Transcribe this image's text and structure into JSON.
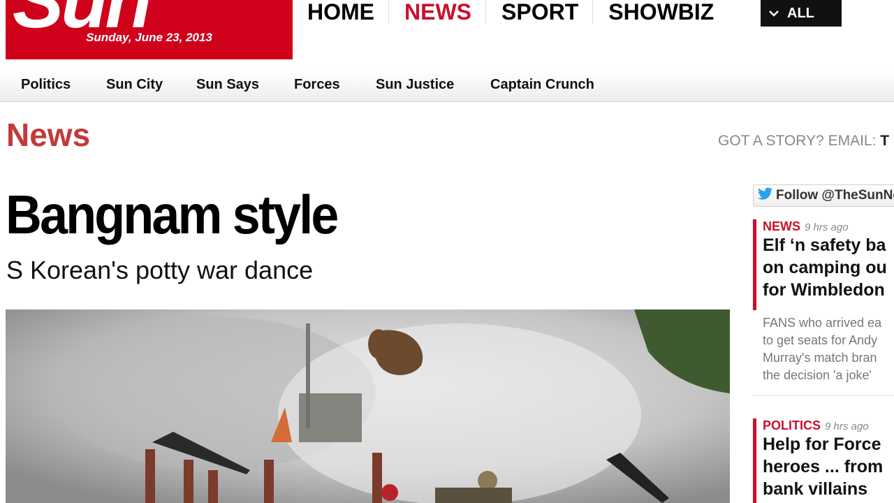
{
  "masthead": {
    "logo_text": "Sun",
    "date": "Sunday, June 23, 2013",
    "brand_color": "#d0021b"
  },
  "topnav": {
    "items": [
      "HOME",
      "NEWS",
      "SPORT",
      "SHOWBIZ"
    ],
    "active": "NEWS",
    "all_label": "ALL"
  },
  "subnav": {
    "items": [
      "Politics",
      "Sun City",
      "Sun Says",
      "Forces",
      "Sun Justice",
      "Captain Crunch"
    ]
  },
  "section": {
    "title": "News",
    "got_story_prefix": "GOT A STORY? EMAIL:",
    "got_story_suffix": "T"
  },
  "article": {
    "headline": "Bangnam style",
    "standfirst": "S Korean's potty war dance",
    "image_icon": "photo-soldiers-throwing-rifles"
  },
  "sidebar": {
    "follow_label": "Follow @TheSunNe",
    "stories": [
      {
        "category": "NEWS",
        "time": "9 hrs ago",
        "title_lines": [
          "Elf ‘n safety ba",
          "on camping ou",
          "for Wimbledon"
        ],
        "body_lines": [
          "FANS who arrived ea",
          "to get seats for Andy",
          "Murray's match bran",
          "the decision 'a joke'"
        ]
      },
      {
        "category": "POLITICS",
        "time": "9 hrs ago",
        "title_lines": [
          "Help for Force",
          "heroes ... from",
          "bank villains"
        ],
        "body_lines": []
      }
    ]
  },
  "colors": {
    "accent": "#c8102e",
    "section_title": "#c23a3a",
    "twitter": "#2aa3ef"
  }
}
